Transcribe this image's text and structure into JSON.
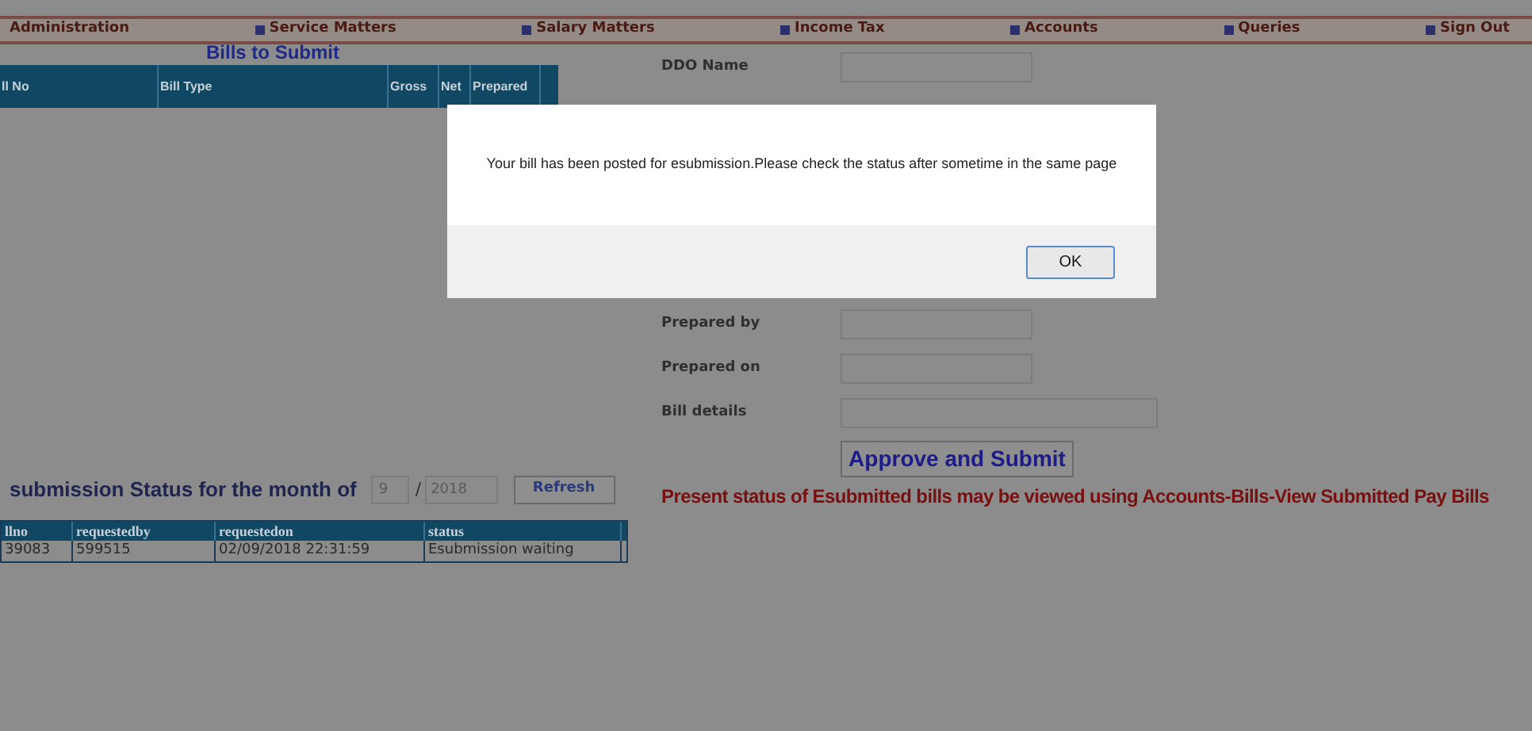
{
  "nav": [
    {
      "label": "Administration",
      "bullet": false
    },
    {
      "label": "Service Matters",
      "bullet": true
    },
    {
      "label": "Salary Matters",
      "bullet": true
    },
    {
      "label": "Income Tax",
      "bullet": true
    },
    {
      "label": "Accounts",
      "bullet": true
    },
    {
      "label": "Queries",
      "bullet": true
    },
    {
      "label": "Sign Out",
      "bullet": true
    }
  ],
  "bills": {
    "title": "Bills to Submit",
    "columns": [
      "ll No",
      "Bill Type",
      "Gross",
      "Net",
      "Prepared"
    ]
  },
  "form": {
    "fields": [
      {
        "label": "DDO Name",
        "wide": false
      },
      {
        "label": "Prepared by",
        "wide": false
      },
      {
        "label": "Prepared on",
        "wide": false
      },
      {
        "label": "Bill details",
        "wide": true
      }
    ],
    "button": "Approve and Submit",
    "notice": "Present status of Esubmitted bills may be viewed using Accounts-Bills-View Submitted Pay Bills"
  },
  "status": {
    "title": "submission Status for the month of",
    "month": "9",
    "separator": "/",
    "year": "2018",
    "refresh": "Refresh",
    "columns": [
      "llno",
      "requestedby",
      "requestedon",
      "status"
    ],
    "rows": [
      [
        "39083",
        "599515",
        "02/09/2018 22:31:59",
        "Esubmission waiting"
      ]
    ]
  },
  "dialog": {
    "message": "Your bill has been posted for esubmission.Please check the status after sometime in the same page",
    "ok": "OK"
  }
}
